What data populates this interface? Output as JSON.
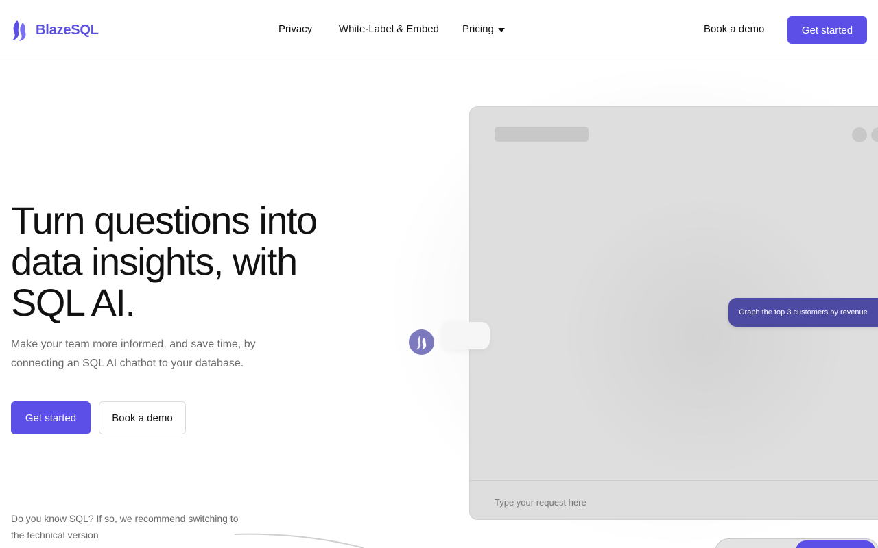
{
  "brand": {
    "name": "BlazeSQL",
    "accent": "#5b4fe8",
    "logo_icon": "flame-icon"
  },
  "nav": {
    "links": [
      {
        "label": "Privacy"
      },
      {
        "label": "White-Label & Embed"
      },
      {
        "label": "Pricing",
        "icon": "chevron-down-icon"
      }
    ],
    "demo_label": "Book a demo",
    "cta_label": "Get started"
  },
  "hero": {
    "title": "Turn questions into data insights, with SQL AI.",
    "subtitle": "Make your team more informed, and save time, by connecting an SQL AI chatbot to your database.",
    "primary_cta": "Get started",
    "secondary_cta": "Book a demo",
    "sql_note": "Do you know SQL? If so, we recommend switching to the technical version"
  },
  "mockup": {
    "chat_message": "Graph the top 3 customers by revenue",
    "input_placeholder": "Type your request here",
    "bot_icon": "flame-icon",
    "bubble_color": "#4d4aa3"
  }
}
